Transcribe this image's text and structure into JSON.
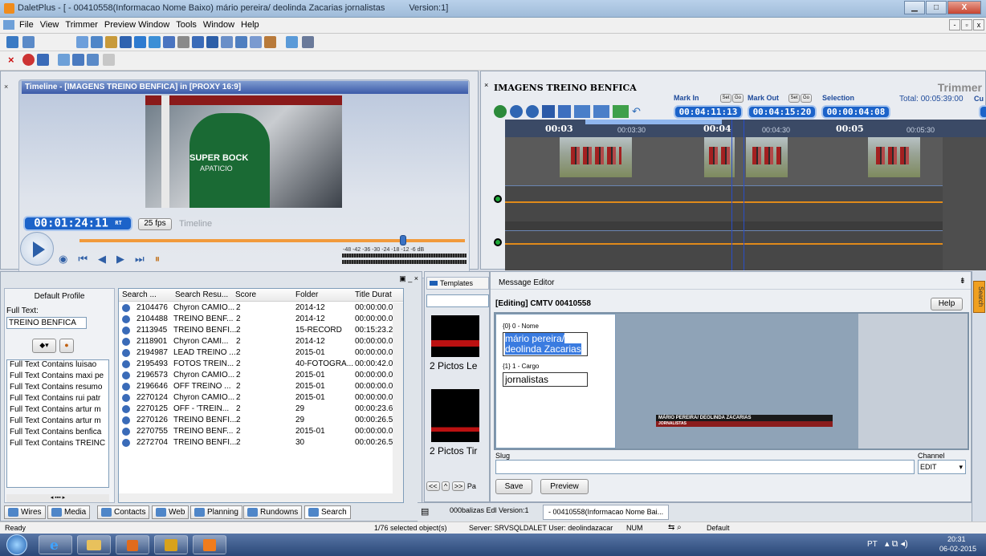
{
  "window": {
    "title": "DaletPlus - [ - 00410558(Informacao Nome Baixo) mário pereira/ deolinda Zacarias jornalistas",
    "version": "Version:1]"
  },
  "menu": [
    "File",
    "View",
    "Trimmer",
    "Preview Window",
    "Tools",
    "Window",
    "Help"
  ],
  "preview": {
    "title": "Timeline - [IMAGENS TREINO BENFICA] in [PROXY 16:9]",
    "timecode": "00:01:24:11",
    "rt": "RT",
    "fps": "25 fps",
    "mode": "Timeline",
    "meter_labels": "-48 -42 -36 -30 -24 -18 -12 -6 dB",
    "frame_text_1": "SUPER BOCK",
    "frame_text_2": "APATICIO",
    "progress": 0.84
  },
  "trimmer": {
    "clip_title": "IMAGENS TREINO BENFICA",
    "panel_title": "Trimmer",
    "total_label": "Total:",
    "total": "00:05:39:00",
    "cue": "Cu",
    "mark_in_label": "Mark In",
    "mark_in": "00:04:11:13",
    "mark_out_label": "Mark Out",
    "mark_out": "00:04:15:20",
    "selection_label": "Selection",
    "selection": "00:00:04:08",
    "set": "Set",
    "go": "Go",
    "ruler": [
      "00:03",
      "00:03:30",
      "00:04",
      "00:04:30",
      "00:05",
      "00:05:30"
    ]
  },
  "search": {
    "profile": "Default Profile",
    "fulltext_label": "Full Text:",
    "fulltext_value": "TREINO BENFICA",
    "filters": [
      "Full Text Contains luisao",
      "Full Text Contains maxi pe",
      "Full Text Contains resumo",
      "Full Text Contains rui patr",
      "Full Text Contains artur m",
      "Full Text Contains artur m",
      "Full Text Contains benfica",
      "Full Text Contains TREINC"
    ],
    "columns": [
      "Search ...",
      "Search Resu...",
      "Score",
      "Folder",
      "Title Durat"
    ],
    "rows": [
      [
        "2104476",
        "Chyron CAMIO...",
        "2",
        "2014-12",
        "00:00:00.0"
      ],
      [
        "2104488",
        "TREINO BENF...",
        "2",
        "2014-12",
        "00:00:00.0"
      ],
      [
        "2113945",
        "TREINO BENFI...",
        "2",
        "15-RECORD",
        "00:15:23.2"
      ],
      [
        "2118901",
        "Chyron CAMI...",
        "2",
        "2014-12",
        "00:00:00.0"
      ],
      [
        "2194987",
        "LEAD TREINO ...",
        "2",
        "2015-01",
        "00:00:00.0"
      ],
      [
        "2195493",
        "FOTOS TREIN...",
        "2",
        "40-FOTOGRA...",
        "00:00:42.0"
      ],
      [
        "2196573",
        "Chyron CAMIO...",
        "2",
        "2015-01",
        "00:00:00.0"
      ],
      [
        "2196646",
        "OFF TREINO ...",
        "2",
        "2015-01",
        "00:00:00.0"
      ],
      [
        "2270124",
        "Chyron CAMIO...",
        "2",
        "2015-01",
        "00:00:00.0"
      ],
      [
        "2270125",
        "OFF - 'TREIN...",
        "2",
        "29",
        "00:00:23.6"
      ],
      [
        "2270126",
        "TREINO BENFI...",
        "2",
        "29",
        "00:00:26.5"
      ],
      [
        "2270755",
        "TREINO BENF...",
        "2",
        "2015-01",
        "00:00:00.0"
      ],
      [
        "2272704",
        "TREINO BENFI...",
        "2",
        "30",
        "00:00:26.5"
      ]
    ]
  },
  "templates": {
    "tab": "Templates",
    "item1": "2 Pictos Le",
    "item2": "2 Pictos Tir",
    "pa": "Pa"
  },
  "editor": {
    "title": "Message Editor",
    "editing": "[Editing] CMTV 00410558",
    "help": "Help",
    "field0_label": "{0} 0 - Nome",
    "field0_value": "mário pereira/ deolinda Zacarias",
    "field1_label": "{1} 1 - Cargo",
    "field1_value": "jornalistas",
    "preview_line1": "MÁRIO PEREIRA/ DEOLINDA ZACARIAS",
    "preview_line2": "JORNALISTAS",
    "slug_label": "Slug",
    "channel_label": "Channel",
    "channel_value": "EDIT",
    "save": "Save",
    "preview": "Preview",
    "side_tab": "Search"
  },
  "bottom_tabs": [
    "Wires",
    "Media",
    "Contacts",
    "Web",
    "Planning",
    "Rundowns",
    "Search"
  ],
  "doc_tabs": [
    "000balizas Edl Version:1",
    "- 00410558(Informacao Nome Bai..."
  ],
  "status": {
    "left": "Ready",
    "selected": "1/76 selected object(s)",
    "server": "Server: SRVSQLDALET User: deolindazacar",
    "num": "NUM",
    "default": "Default"
  },
  "clock": {
    "lang": "PT",
    "time": "20:31",
    "date": "06-02-2015"
  },
  "colors": {
    "lcd": "#1c63c9",
    "waveform": "#e08a1a",
    "timeline_bg": "#3c3c3c"
  }
}
